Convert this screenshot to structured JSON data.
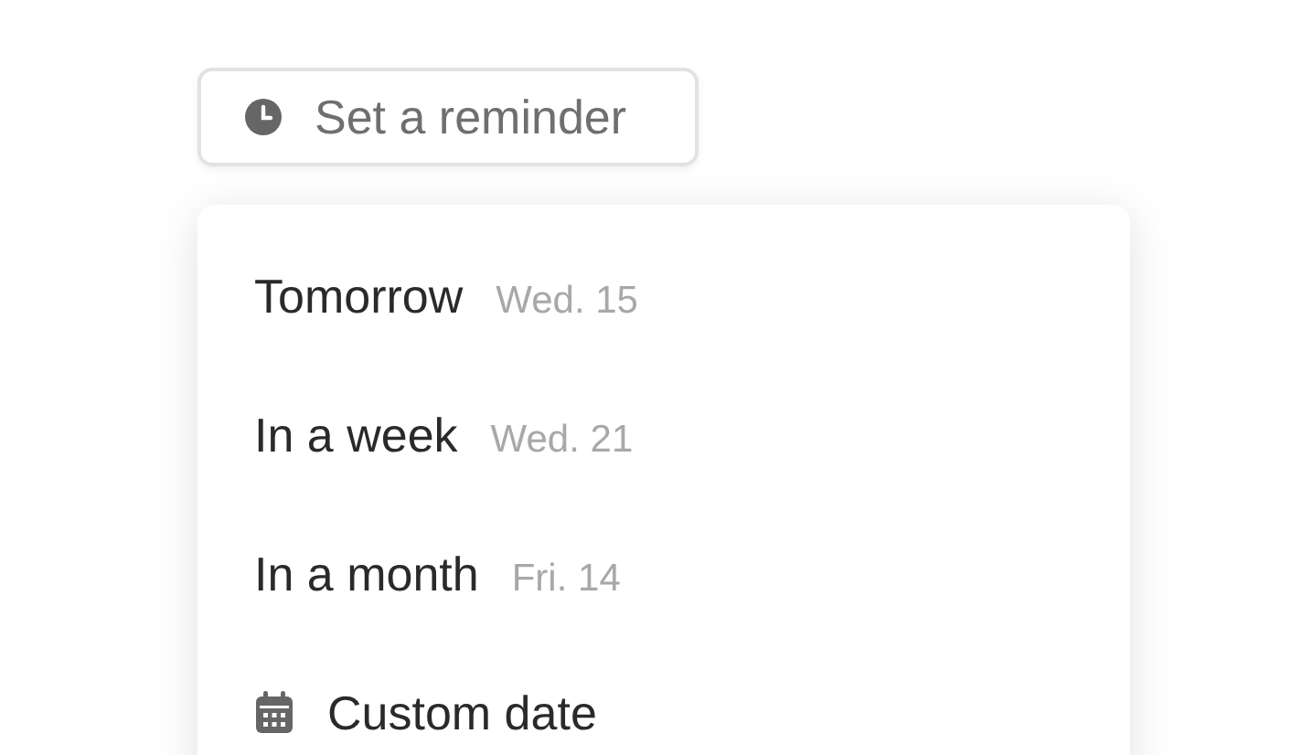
{
  "reminder_button": {
    "label": "Set a reminder"
  },
  "menu": {
    "items": [
      {
        "kind": "date",
        "label": "Tomorrow",
        "date": "Wed. 15"
      },
      {
        "kind": "date",
        "label": "In a week",
        "date": "Wed. 21"
      },
      {
        "kind": "date",
        "label": "In a month",
        "date": "Fri. 14"
      },
      {
        "kind": "custom",
        "label": "Custom date"
      }
    ]
  }
}
